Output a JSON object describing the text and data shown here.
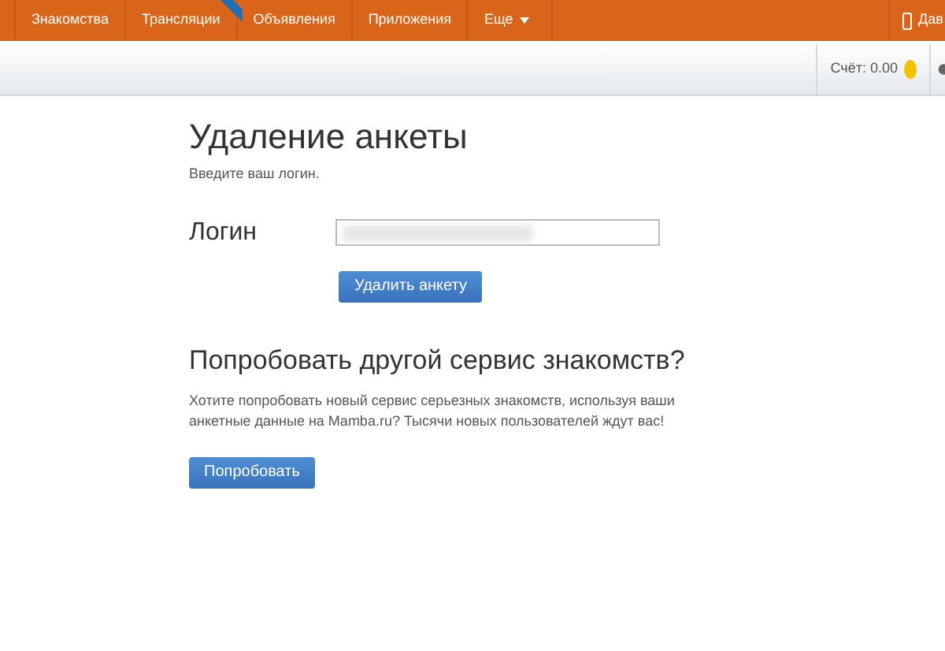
{
  "nav": {
    "items": [
      {
        "label": "Знакомства",
        "kind": "link"
      },
      {
        "label": "Трансляции",
        "kind": "ribbon"
      },
      {
        "label": "Объявления",
        "kind": "link"
      },
      {
        "label": "Приложения",
        "kind": "link"
      },
      {
        "label": "Еще",
        "kind": "dropdown"
      }
    ],
    "right_label": "Дав"
  },
  "subbar": {
    "balance": "Счёт: 0.00"
  },
  "page": {
    "title": "Удаление анкеты",
    "hint": "Введите ваш логин.",
    "login_label": "Логин",
    "delete_button": "Удалить анкету",
    "promo_title": "Попробовать другой сервис знакомств?",
    "promo_text": "Хотите попробовать новый сервис серьезных знакомств, используя ваши анкетные данные на Mamba.ru? Тысячи новых пользователей ждут вас!",
    "try_button": "Попробовать"
  }
}
